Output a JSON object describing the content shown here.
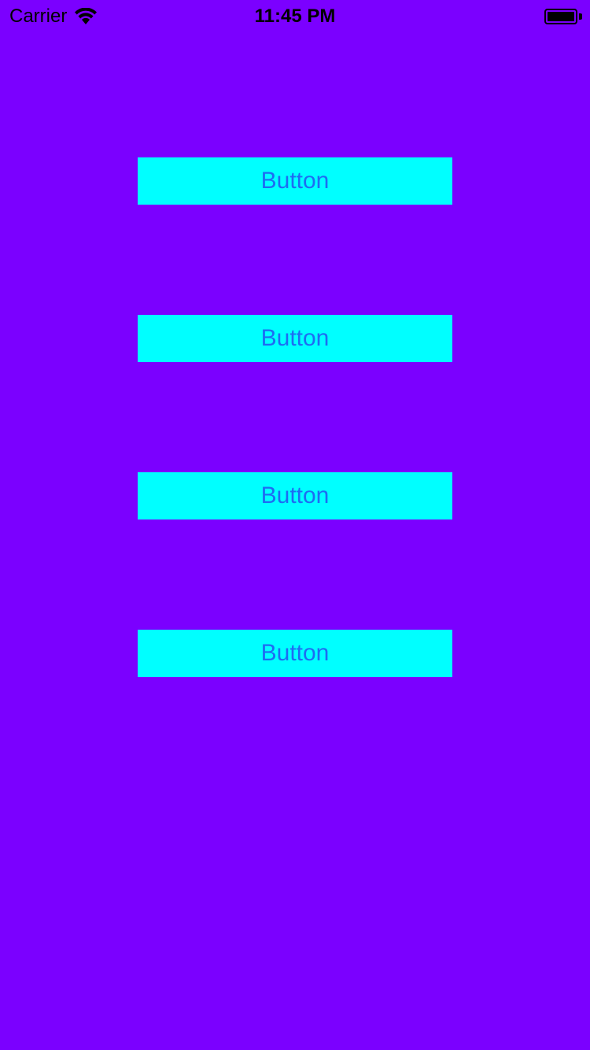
{
  "status_bar": {
    "carrier": "Carrier",
    "time": "11:45 PM",
    "wifi_icon": "wifi-icon",
    "battery_icon": "battery-icon",
    "battery_level": 1.0
  },
  "buttons": [
    {
      "label": "Button"
    },
    {
      "label": "Button"
    },
    {
      "label": "Button"
    },
    {
      "label": "Button"
    }
  ],
  "colors": {
    "background": "#7b00ff",
    "button_background": "#00ffff",
    "button_text": "#1e6cf2",
    "status_text": "#000000"
  }
}
